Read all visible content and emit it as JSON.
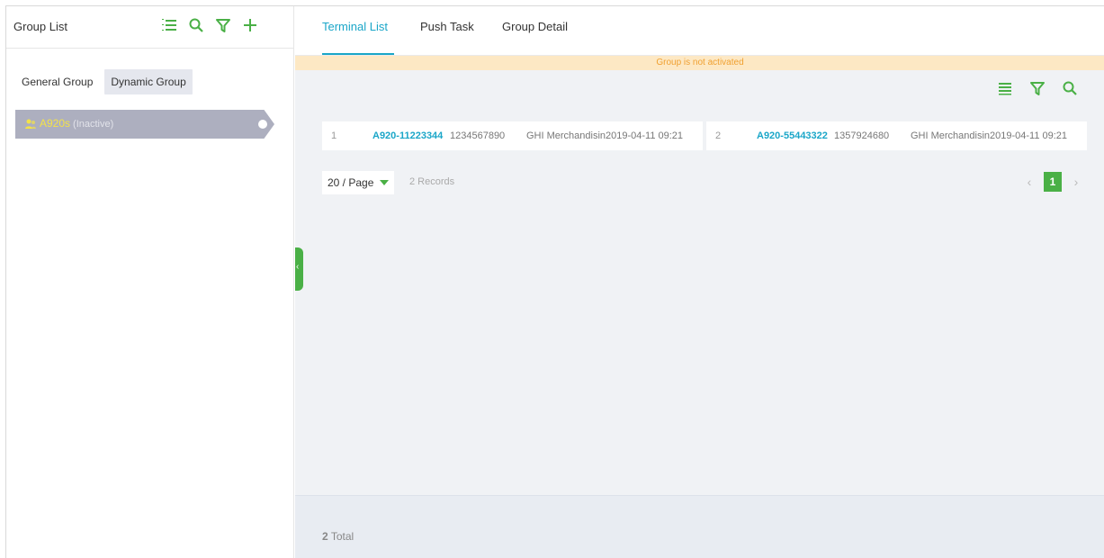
{
  "sidebar": {
    "title": "Group List",
    "tabs": [
      {
        "label": "General Group"
      },
      {
        "label": "Dynamic Group"
      }
    ],
    "items": [
      {
        "name": "A920s",
        "status": "(Inactive)"
      }
    ]
  },
  "main": {
    "tabs": [
      {
        "label": "Terminal List"
      },
      {
        "label": "Push Task"
      },
      {
        "label": "Group Detail"
      }
    ],
    "banner": "Group is not activated",
    "rows": [
      {
        "index": "1",
        "name": "A920-11223344",
        "serial": "1234567890",
        "merchant": "GHI Merchandising",
        "time": "2019-04-11 09:21"
      },
      {
        "index": "2",
        "name": "A920-55443322",
        "serial": "1357924680",
        "merchant": "GHI Merchandising",
        "time": "2019-04-11 09:21"
      }
    ],
    "page_size": "20 / Page",
    "records": "2 Records",
    "current_page": "1",
    "total_count": "2",
    "total_label": "Total"
  },
  "colors": {
    "accent": "#1aa6c8",
    "green": "#4ab046",
    "banner_text": "#f0a030",
    "banner_bg": "#fde8c4",
    "group_name": "#f3e24a"
  }
}
